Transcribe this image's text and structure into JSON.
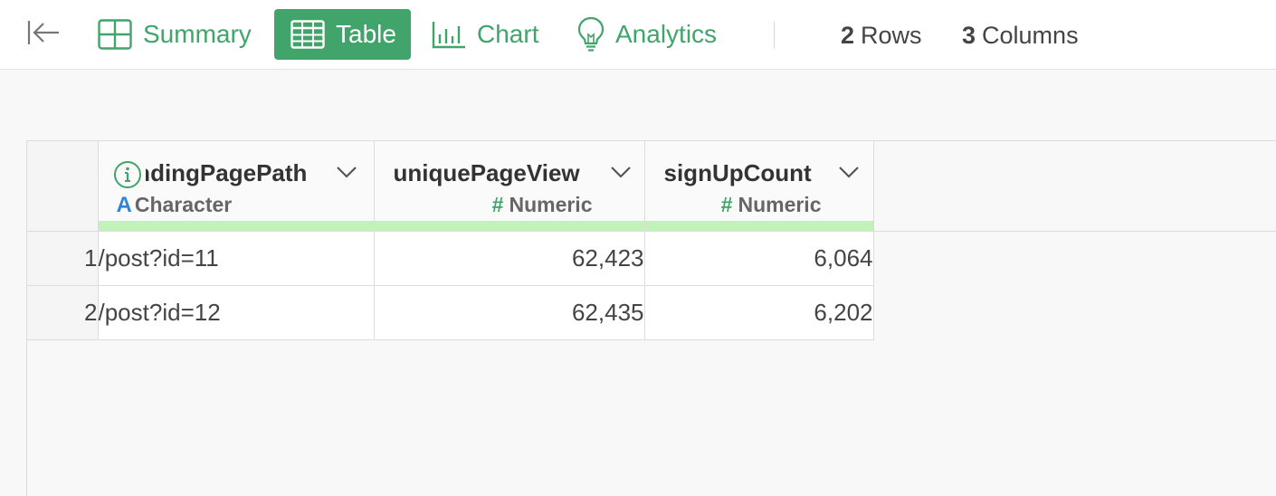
{
  "toolbar": {
    "collapse_icon": "collapse-left-icon",
    "tabs": [
      {
        "label": "Summary",
        "icon": "summary-grid-icon"
      },
      {
        "label": "Table",
        "icon": "table-icon"
      },
      {
        "label": "Chart",
        "icon": "bar-chart-icon"
      },
      {
        "label": "Analytics",
        "icon": "lightbulb-icon"
      }
    ],
    "active_tab": "Table",
    "rows_count": "2",
    "rows_label": "Rows",
    "cols_count": "3",
    "cols_label": "Columns"
  },
  "table": {
    "columns": [
      {
        "name": "landingPagePath",
        "type": "Character",
        "type_symbol": "A"
      },
      {
        "name": "uniquePageView",
        "type": "Numeric",
        "type_symbol": "#"
      },
      {
        "name": "signUpCount",
        "type": "Numeric",
        "type_symbol": "#"
      }
    ],
    "rows": [
      {
        "index": "1",
        "cells": [
          "/post?id=11",
          "62,423",
          "6,064"
        ]
      },
      {
        "index": "2",
        "cells": [
          "/post?id=12",
          "62,435",
          "6,202"
        ]
      }
    ]
  },
  "colors": {
    "accent": "#41a46a",
    "character_type": "#2f86d6",
    "header_bar": "#c2f2b8"
  }
}
